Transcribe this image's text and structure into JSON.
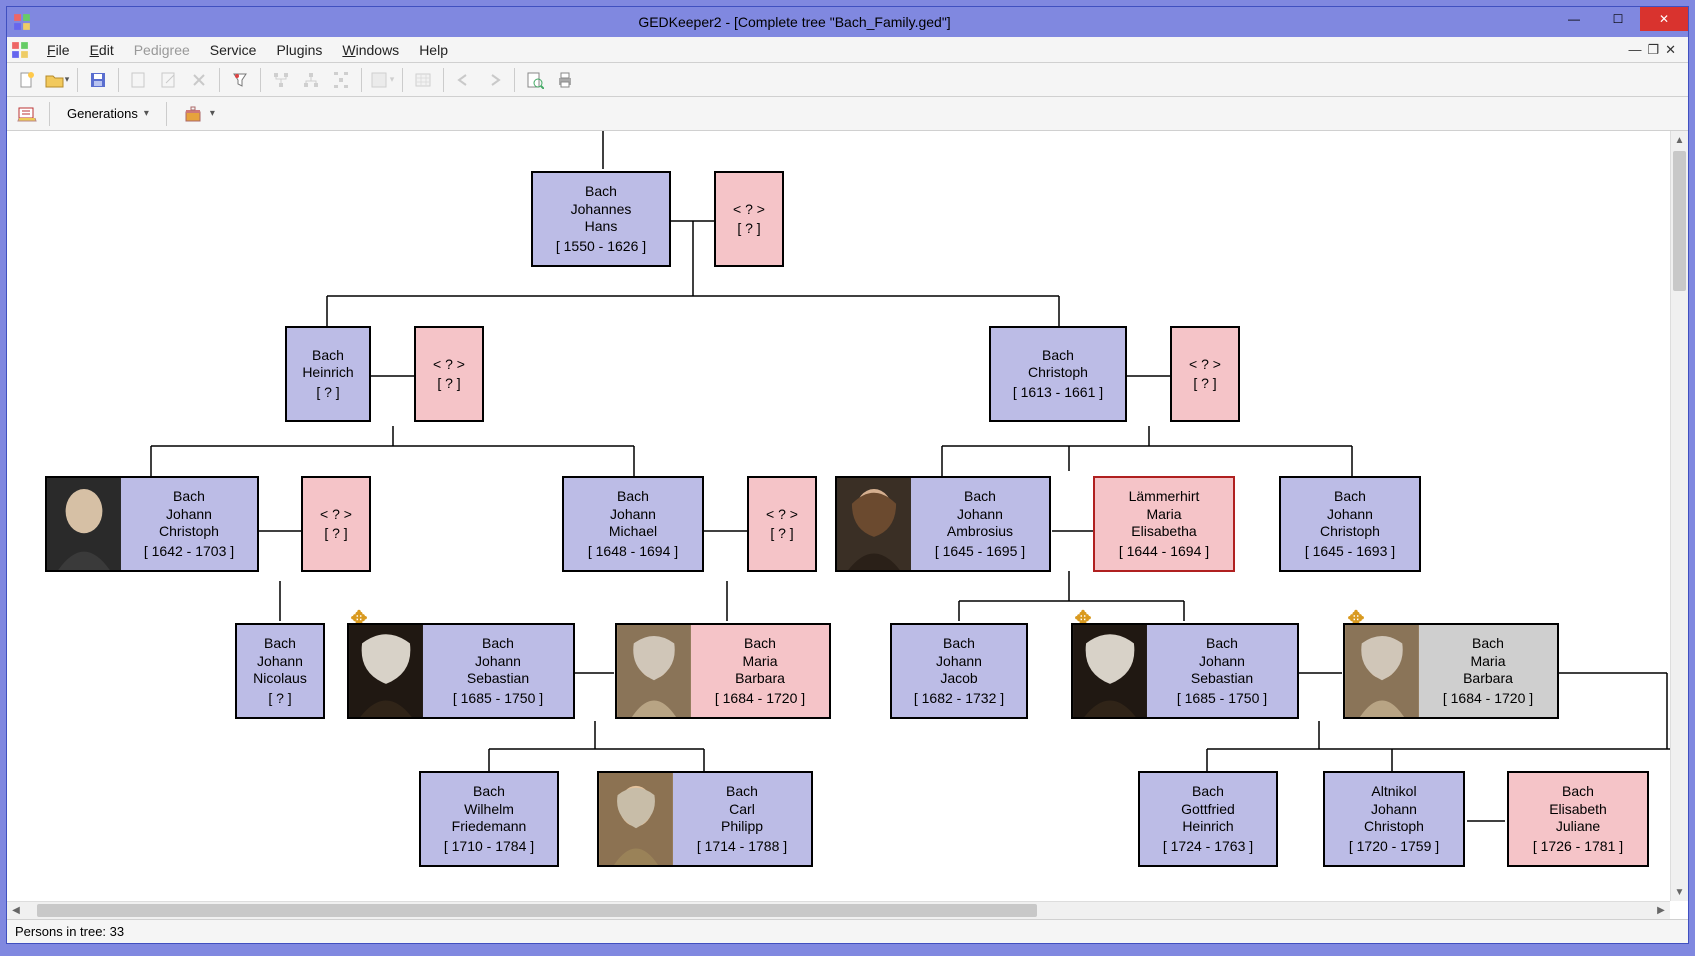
{
  "window": {
    "title": "GEDKeeper2 - [Complete tree \"Bach_Family.ged\"]"
  },
  "menu": {
    "file": "File",
    "edit": "Edit",
    "pedigree": "Pedigree",
    "service": "Service",
    "plugins": "Plugins",
    "windows": "Windows",
    "help": "Help"
  },
  "toolbar2": {
    "generations": "Generations"
  },
  "status": {
    "persons": "Persons in tree: 33"
  },
  "people": {
    "johannes": {
      "surname": "Bach",
      "given1": "Johannes",
      "given2": "Hans",
      "dates": "[ 1550 - 1626 ]"
    },
    "jh_spouse": {
      "line1": "< ? >",
      "dates": "[ ? ]"
    },
    "heinrich": {
      "surname": "Bach",
      "given1": "Heinrich",
      "dates": "[ ? ]"
    },
    "he_spouse": {
      "line1": "< ? >",
      "dates": "[ ? ]"
    },
    "christoph1": {
      "surname": "Bach",
      "given1": "Christoph",
      "dates": "[ 1613 - 1661 ]"
    },
    "ch_spouse": {
      "line1": "< ? >",
      "dates": "[ ? ]"
    },
    "jchristoph1": {
      "surname": "Bach",
      "given1": "Johann",
      "given2": "Christoph",
      "dates": "[ 1642 - 1703 ]"
    },
    "jc_spouse": {
      "line1": "< ? >",
      "dates": "[ ? ]"
    },
    "jmichael": {
      "surname": "Bach",
      "given1": "Johann",
      "given2": "Michael",
      "dates": "[ 1648 - 1694 ]"
    },
    "jm_spouse": {
      "line1": "< ? >",
      "dates": "[ ? ]"
    },
    "jambrosius": {
      "surname": "Bach",
      "given1": "Johann",
      "given2": "Ambrosius",
      "dates": "[ 1645 - 1695 ]"
    },
    "lammerhirt": {
      "surname": "Lämmerhirt",
      "given1": "Maria",
      "given2": "Elisabetha",
      "dates": "[ 1644 - 1694 ]"
    },
    "jchristoph2": {
      "surname": "Bach",
      "given1": "Johann",
      "given2": "Christoph",
      "dates": "[ 1645 - 1693 ]"
    },
    "nicolaus": {
      "surname": "Bach",
      "given1": "Johann",
      "given2": "Nicolaus",
      "dates": "[ ? ]"
    },
    "jsb1": {
      "surname": "Bach",
      "given1": "Johann",
      "given2": "Sebastian",
      "dates": "[ 1685 - 1750 ]"
    },
    "mbarbara1": {
      "surname": "Bach",
      "given1": "Maria",
      "given2": "Barbara",
      "dates": "[ 1684 - 1720 ]"
    },
    "jjacob": {
      "surname": "Bach",
      "given1": "Johann",
      "given2": "Jacob",
      "dates": "[ 1682 - 1732 ]"
    },
    "jsb2": {
      "surname": "Bach",
      "given1": "Johann",
      "given2": "Sebastian",
      "dates": "[ 1685 - 1750 ]"
    },
    "mbarbara2": {
      "surname": "Bach",
      "given1": "Maria",
      "given2": "Barbara",
      "dates": "[ 1684 - 1720 ]"
    },
    "wfriedemann": {
      "surname": "Bach",
      "given1": "Wilhelm",
      "given2": "Friedemann",
      "dates": "[ 1710 - 1784 ]"
    },
    "cphilipp": {
      "surname": "Bach",
      "given1": "Carl",
      "given2": "Philipp",
      "dates": "[ 1714 - 1788 ]"
    },
    "gottfried": {
      "surname": "Bach",
      "given1": "Gottfried",
      "given2": "Heinrich",
      "dates": "[ 1724 - 1763 ]"
    },
    "altnikol": {
      "surname": "Altnikol",
      "given1": "Johann",
      "given2": "Christoph",
      "dates": "[ 1720 - 1759 ]"
    },
    "elizjuliane": {
      "surname": "Bach",
      "given1": "Elisabeth",
      "given2": "Juliane",
      "dates": "[ 1726 - 1781 ]"
    }
  },
  "colors": {
    "male": "#bcbce6",
    "female": "#f5c4c8",
    "selected_border": "#b02020"
  }
}
